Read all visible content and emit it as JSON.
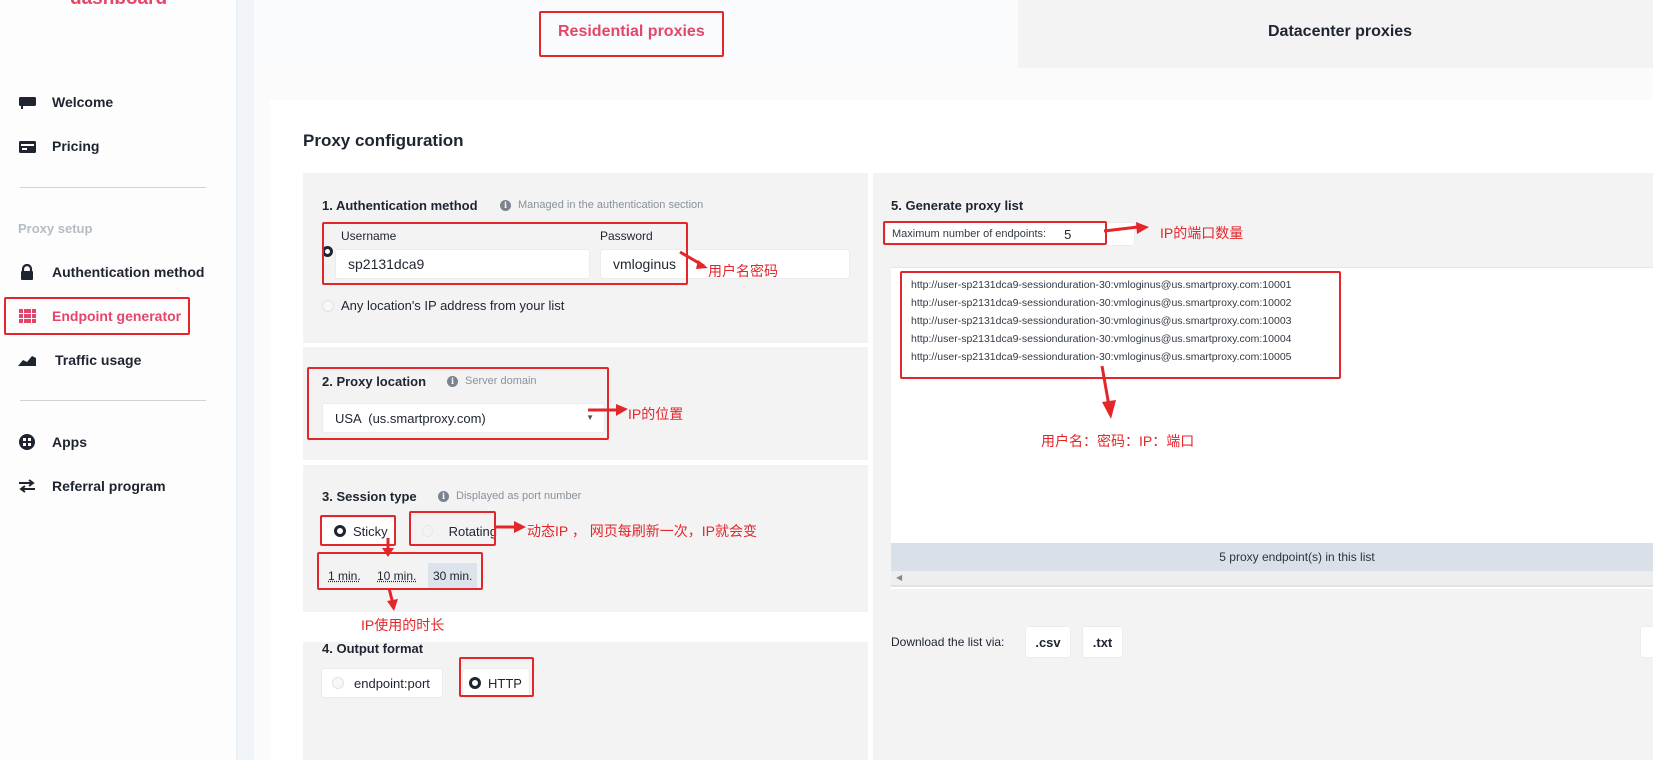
{
  "brand": "dashboard",
  "sidebar": {
    "items": [
      {
        "label": "Welcome",
        "icon": "monitor-icon"
      },
      {
        "label": "Pricing",
        "icon": "credit-card-icon"
      },
      {
        "label": "Authentication method",
        "icon": "lock-icon"
      },
      {
        "label": "Endpoint generator",
        "icon": "server-icon",
        "active": true
      },
      {
        "label": "Traffic usage",
        "icon": "chart-area-icon"
      },
      {
        "label": "Apps",
        "icon": "apps-icon"
      },
      {
        "label": "Referral program",
        "icon": "swap-arrows-icon"
      }
    ],
    "section_label": "Proxy setup"
  },
  "tabs": [
    {
      "label": "Residential proxies",
      "active": true
    },
    {
      "label": "Datacenter proxies",
      "active": false
    }
  ],
  "page_title": "Proxy configuration",
  "auth": {
    "title": "1. Authentication method",
    "hint": "Managed in the authentication section",
    "username_label": "Username",
    "username_value": "sp2131dca9",
    "password_label": "Password",
    "password_value": "vmloginus",
    "alt_option": "Any location's IP address from your list"
  },
  "location": {
    "title": "2. Proxy location",
    "hint": "Server domain",
    "selected": "USA  (us.smartproxy.com)"
  },
  "session": {
    "title": "3. Session type",
    "hint": "Displayed as port number",
    "options": [
      "Sticky",
      "Rotating"
    ],
    "selected": "Sticky",
    "durations": [
      "1 min.",
      "10 min.",
      "30 min."
    ],
    "selected_duration": "30 min."
  },
  "output": {
    "title": "4. Output format",
    "options": [
      "endpoint:port",
      "HTTP"
    ],
    "selected": "HTTP"
  },
  "generate": {
    "title": "5. Generate proxy list",
    "max_label": "Maximum number of endpoints:",
    "max_value": "5",
    "endpoints": [
      "http://user-sp2131dca9-sessionduration-30:vmloginus@us.smartproxy.com:10001",
      "http://user-sp2131dca9-sessionduration-30:vmloginus@us.smartproxy.com:10002",
      "http://user-sp2131dca9-sessionduration-30:vmloginus@us.smartproxy.com:10003",
      "http://user-sp2131dca9-sessionduration-30:vmloginus@us.smartproxy.com:10004",
      "http://user-sp2131dca9-sessionduration-30:vmloginus@us.smartproxy.com:10005"
    ],
    "count_text": "5 proxy endpoint(s) in this list",
    "download_label": "Download the list via:",
    "download_buttons": [
      ".csv",
      ".txt"
    ]
  },
  "annotations": {
    "user_pass": "用户名密码",
    "ip_location": "IP的位置",
    "rotating": "动态IP ， 网页每刷新一次，IP就会变",
    "duration": "IP使用的时长",
    "port_count": "IP的端口数量",
    "format": "用户名：密码：IP：端口"
  },
  "colors": {
    "accent": "#e4466a",
    "annotation": "#e3262a"
  }
}
